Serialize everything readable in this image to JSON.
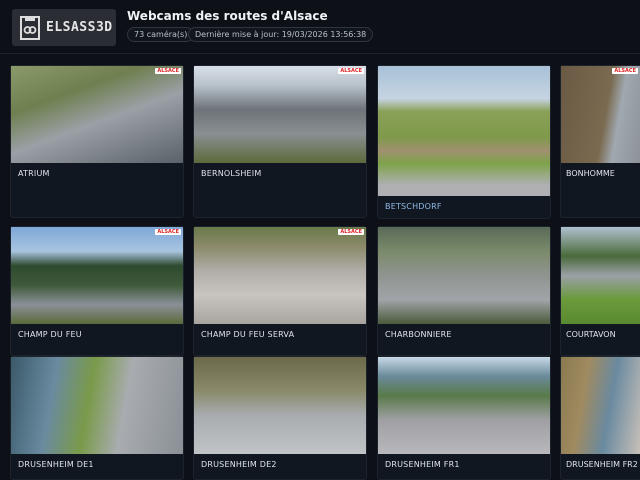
{
  "header": {
    "logo_text": "ELSASS3D",
    "title": "Webcams des routes d'Alsace",
    "camera_count": "73 caméra(s)",
    "last_update": "Dernière mise à jour: 19/03/2026 13:56:38"
  },
  "cameras": [
    {
      "name": "ATRIUM",
      "tag": "ALSACE",
      "bg": "linear-gradient(160deg,#8a9a6a 0%,#6f7f4f 30%,#9aa0a6 55%,#5a6168 100%)"
    },
    {
      "name": "BERNOLSHEIM",
      "tag": "ALSACE",
      "bg": "linear-gradient(180deg,#d8dfe8 0%,#b8c2ca 20%,#6d7378 45%,#8a8f92 70%,#5c6a3a 100%)"
    },
    {
      "name": "BETSCHDORF",
      "tag": "",
      "bg": "linear-gradient(180deg,#a8c0d8 0%,#c6d4e2 25%,#8aa058 35%,#7f9a4a 55%,#a09070 65%,#7ea34a 75%,#b0b0b4 92%)"
    },
    {
      "name": "BONHOMME",
      "tag": "ALSACE",
      "bg": "linear-gradient(100deg,#6a5a44 0%,#7a6a50 55%,#a0a8b0 70%,#8c9298 100%)"
    },
    {
      "name": "CHAMP DU FEU",
      "tag": "ALSACE",
      "bg": "linear-gradient(180deg,#7fa8d8 0%,#a8c4e0 25%,#2e4a2e 40%,#3f5a3a 60%,#8a9098 80%,#5a6a3a 100%)"
    },
    {
      "name": "CHAMP DU FEU SERVA",
      "tag": "ALSACE",
      "bg": "linear-gradient(180deg,#6a7a4a 0%,#8a8a6a 20%,#b0aca8 45%,#c8c4c0 70%,#a8a4a0 100%)"
    },
    {
      "name": "CHARBONNIERE",
      "tag": "",
      "bg": "linear-gradient(180deg,#5a6a5a 0%,#7a8a6a 25%,#909490 50%,#a0a4a8 75%,#4a5a3a 100%)"
    },
    {
      "name": "COURTAVON",
      "tag": "",
      "bg": "linear-gradient(180deg,#b0c0d0 0%,#4a6a3a 30%,#9aa0a6 50%,#6a9a3a 75%,#5a8a30 100%)"
    },
    {
      "name": "DRUSENHEIM DE1",
      "tag": "",
      "bg": "linear-gradient(100deg,#3a5a6a 0%,#6a8aa0 25%,#7a9a4a 45%,#a8acb0 65%,#8a9096 100%)"
    },
    {
      "name": "DRUSENHEIM DE2",
      "tag": "",
      "bg": "linear-gradient(180deg,#6a6a4a 0%,#8a8a6a 35%,#a8acb0 60%,#c0c4c6 100%)"
    },
    {
      "name": "DRUSENHEIM FR1",
      "tag": "",
      "bg": "linear-gradient(180deg,#c8d8e8 0%,#6a8a9a 20%,#5a7a4a 40%,#a0a0a4 65%,#b8b8bc 100%)"
    },
    {
      "name": "DRUSENHEIM FR2",
      "tag": "",
      "bg": "linear-gradient(100deg,#8a7a50 0%,#a08a60 30%,#6a8aa0 60%,#c8c0b8 100%)"
    }
  ]
}
